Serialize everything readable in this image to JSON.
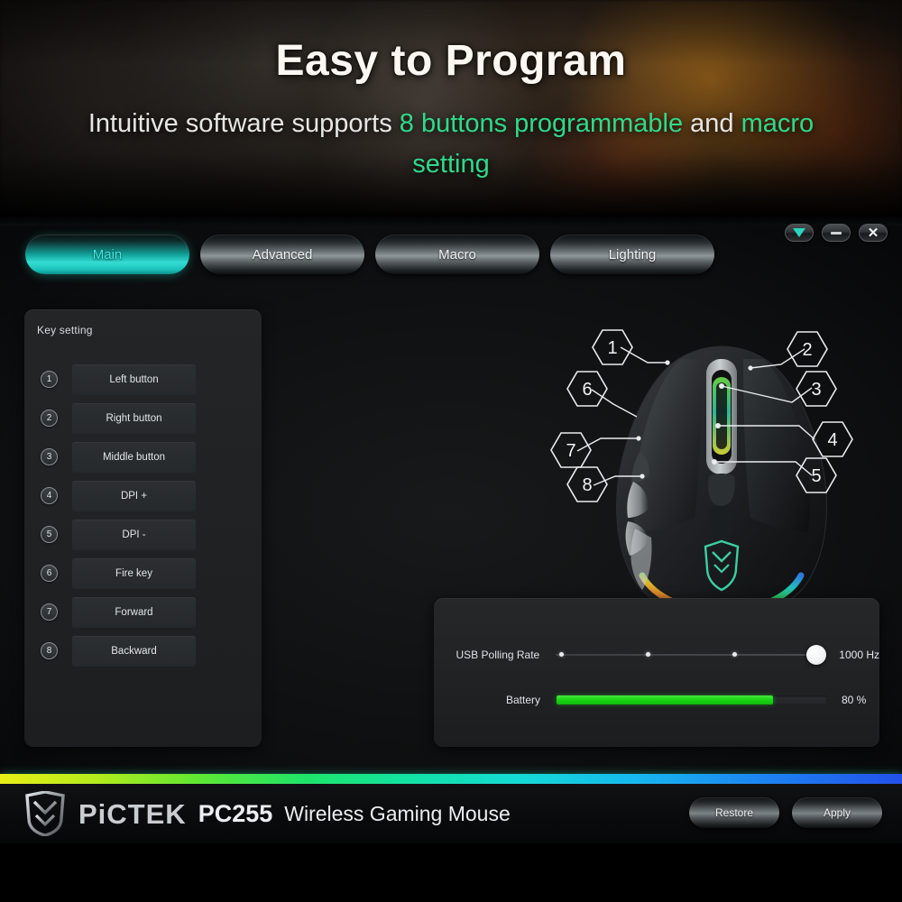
{
  "banner": {
    "headline": "Easy to Program",
    "subline_pre": "Intuitive software supports ",
    "subline_accent1": "8 buttons programmable",
    "subline_mid": " and ",
    "subline_accent2": "macro setting",
    "accent_color": "#2fd98b"
  },
  "window_controls": [
    {
      "name": "tray-minimize",
      "glyph": "▼"
    },
    {
      "name": "minimize",
      "glyph": "—"
    },
    {
      "name": "close",
      "glyph": "✕"
    }
  ],
  "tabs": [
    {
      "label": "Main",
      "active": true
    },
    {
      "label": "Advanced",
      "active": false
    },
    {
      "label": "Macro",
      "active": false
    },
    {
      "label": "Lighting",
      "active": false
    }
  ],
  "key_setting": {
    "title": "Key setting",
    "rows": [
      {
        "number": "1",
        "label": "Left button"
      },
      {
        "number": "2",
        "label": "Right button"
      },
      {
        "number": "3",
        "label": "Middle button"
      },
      {
        "number": "4",
        "label": "DPI +"
      },
      {
        "number": "5",
        "label": "DPI -"
      },
      {
        "number": "6",
        "label": "Fire key"
      },
      {
        "number": "7",
        "label": "Forward"
      },
      {
        "number": "8",
        "label": "Backward"
      }
    ]
  },
  "mouse_diagram": {
    "callouts": [
      "1",
      "2",
      "3",
      "4",
      "5",
      "6",
      "7",
      "8"
    ]
  },
  "settings": {
    "polling": {
      "label": "USB Polling Rate",
      "value": "1000 Hz",
      "position_percent": 100,
      "tick_percents": [
        2,
        34,
        66
      ]
    },
    "battery": {
      "label": "Battery",
      "value": "80 %",
      "percent": 80,
      "fill_color": "#18d512"
    }
  },
  "footer": {
    "brand": "PiCTEK",
    "model": "PC255",
    "model_desc": "Wireless Gaming Mouse",
    "restore_label": "Restore",
    "apply_label": "Apply"
  }
}
